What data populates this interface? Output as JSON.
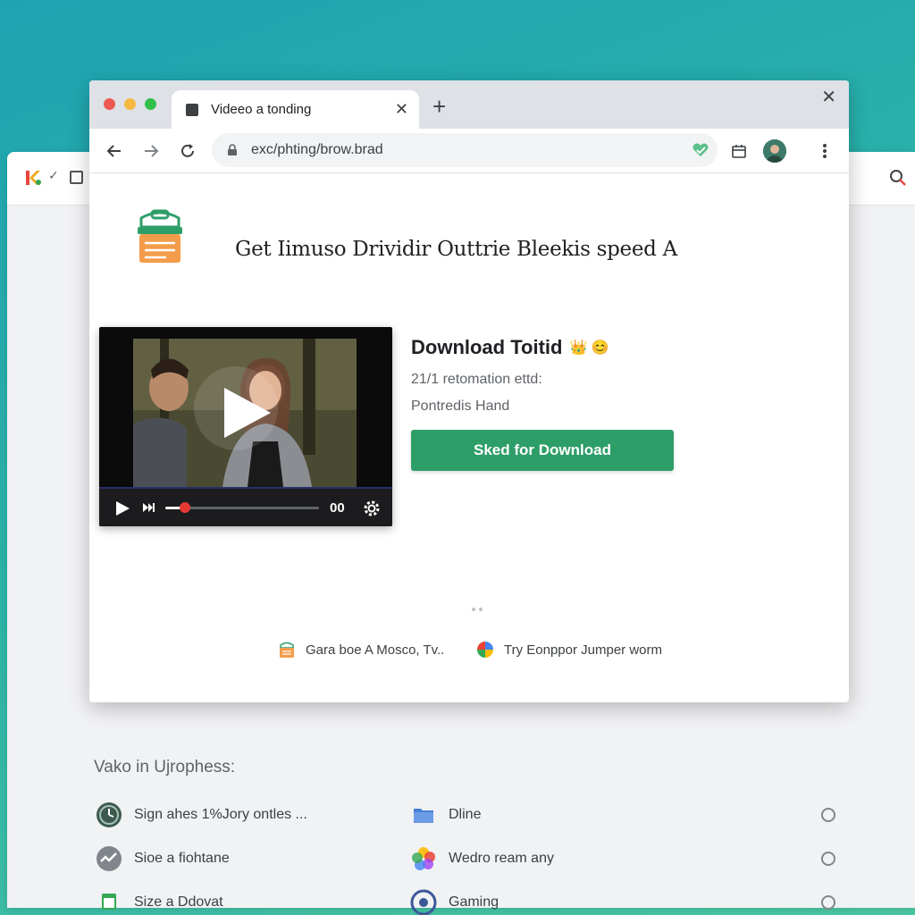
{
  "window": {
    "tab_title": "Videeo a tonding",
    "url": "exc/phting/brow.brad"
  },
  "page": {
    "heading": "Get Iimuso Drividir Outtrie Bleekis speed A",
    "download_title": "Download Toitid",
    "download_title_emoji": "👑 😊",
    "meta_line_1": "21/1 retomation ettd:",
    "meta_line_2": "Pontredis Hand",
    "download_button": "Sked for Download",
    "video_time": "00",
    "video_progress_fraction": 0.13,
    "footer_links": [
      {
        "label": "Gara boe A Mosco, Tv.."
      },
      {
        "label": "Try Eonppor Jumper worm"
      }
    ]
  },
  "back_window": {
    "section_title": "Vako in Ujrophess:",
    "list_left": [
      {
        "label": "Sign ahes 1%Jory ontles ..."
      },
      {
        "label": "Sioe a fiohtane"
      },
      {
        "label": "Size a Ddovat"
      }
    ],
    "list_right": [
      {
        "label": "Dline"
      },
      {
        "label": "Wedro ream any"
      },
      {
        "label": "Gaming"
      }
    ]
  },
  "colors": {
    "accent": "#2e9e68",
    "background_gradient_start": "#1ea3b3",
    "background_gradient_end": "#4cc7a3",
    "progress_knob": "#e53935"
  }
}
